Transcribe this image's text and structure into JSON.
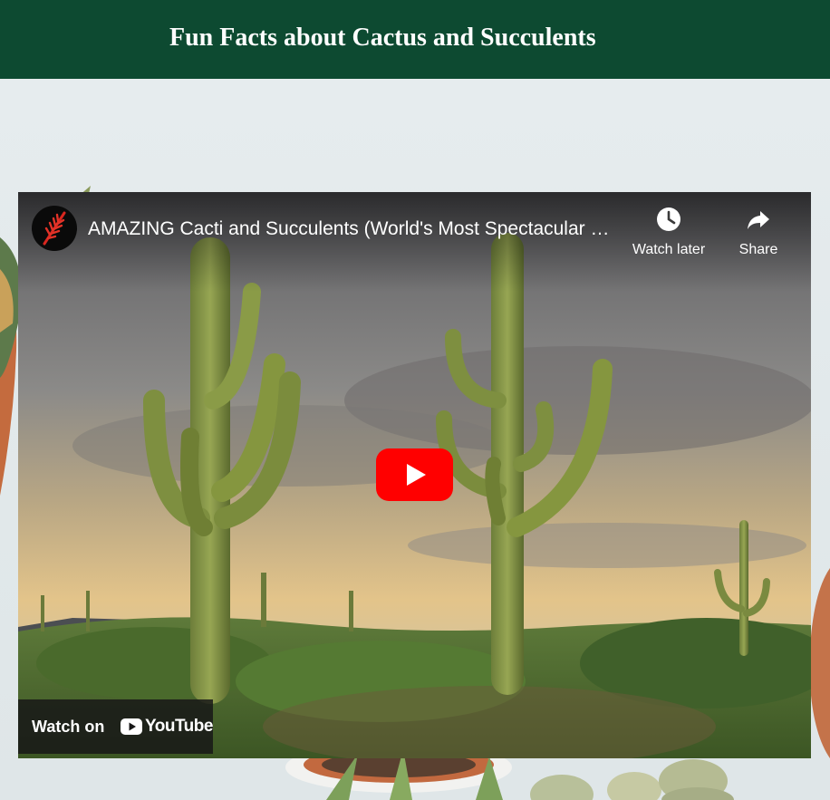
{
  "page": {
    "title": "Fun Facts about Cactus and Succulents",
    "colors": {
      "header_bg": "#0d4a31",
      "header_text": "#ffffff",
      "page_bg": "#e3eaeb"
    }
  },
  "video": {
    "title": "AMAZING Cacti and Succulents (World's Most Spectacular Cactus and Succulent Plants)",
    "channel_avatar": "red-leaf-logo",
    "watch_later_label": "Watch later",
    "share_label": "Share",
    "watch_on_label": "Watch on",
    "youtube_wordmark": "YouTube",
    "play_button_color": "#ff0000",
    "icons": [
      "clock-icon",
      "share-arrow-icon",
      "play-icon",
      "youtube-logo-icon"
    ]
  }
}
